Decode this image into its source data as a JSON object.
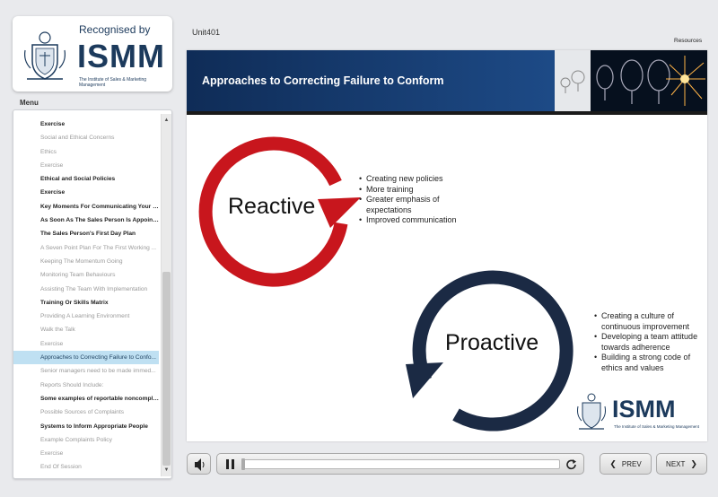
{
  "logo": {
    "recognised": "Recognised by",
    "brand": "ISMM",
    "tagline": "The Institute of Sales & Marketing Management"
  },
  "menu": {
    "title": "Menu",
    "items": [
      {
        "label": "Exercise",
        "state": "bold"
      },
      {
        "label": "Social and Ethical Concerns",
        "state": "done"
      },
      {
        "label": "Ethics",
        "state": "done"
      },
      {
        "label": "Exercise",
        "state": "done"
      },
      {
        "label": "Ethical and Social Policies",
        "state": "bold"
      },
      {
        "label": "Exercise",
        "state": "bold"
      },
      {
        "label": "Key Moments For Communicating Your E...",
        "state": "bold"
      },
      {
        "label": "As Soon As The Sales Person Is Appointed",
        "state": "bold"
      },
      {
        "label": "The Sales Person's First Day Plan",
        "state": "bold"
      },
      {
        "label": "A Seven Point Plan For The First Working ...",
        "state": "done"
      },
      {
        "label": "Keeping The Momentum Going",
        "state": "done"
      },
      {
        "label": "Monitoring Team Behaviours",
        "state": "done"
      },
      {
        "label": "Assisting The Team With Implementation",
        "state": "done"
      },
      {
        "label": "Training Or Skills Matrix",
        "state": "bold"
      },
      {
        "label": "Providing A Learning Environment",
        "state": "done"
      },
      {
        "label": "Walk the Talk",
        "state": "done"
      },
      {
        "label": "Exercise",
        "state": "done"
      },
      {
        "label": "Approaches to Correcting Failure to Confo...",
        "state": "active"
      },
      {
        "label": "Senior managers need to be made immed...",
        "state": "done"
      },
      {
        "label": "Reports Should Include:",
        "state": "done"
      },
      {
        "label": "Some examples of reportable noncomplia...",
        "state": "bold"
      },
      {
        "label": "Possible Sources of Complaints",
        "state": "done"
      },
      {
        "label": "Systems to Inform Appropriate People",
        "state": "bold"
      },
      {
        "label": "Example Complaints Policy",
        "state": "done"
      },
      {
        "label": "Exercise",
        "state": "done"
      },
      {
        "label": "End Of Session",
        "state": "done"
      }
    ]
  },
  "header": {
    "unit": "Unit401",
    "resources": "Resources"
  },
  "slide": {
    "title": "Approaches to Correcting Failure to Conform",
    "reactive": {
      "label": "Reactive",
      "bullets": [
        "Creating new policies",
        "More training",
        "Greater emphasis of expectations",
        "Improved communication"
      ]
    },
    "proactive": {
      "label": "Proactive",
      "bullets": [
        "Creating a culture of continuous improvement",
        "Developing a team attitude towards adherence",
        "Building a strong code of ethics and values"
      ]
    },
    "logo": {
      "brand": "ISMM",
      "tagline": "The Institute of Sales & Marketing Management"
    }
  },
  "controls": {
    "prev": "PREV",
    "next": "NEXT",
    "progress": 0.0
  },
  "colors": {
    "reactive": "#c8161d",
    "proactive": "#1b2a44",
    "active_menu": "#bfe0f2",
    "brand": "#1c3a5c"
  },
  "icons": [
    "speaker-icon",
    "pause-icon",
    "replay-icon",
    "chevron-left-icon",
    "chevron-right-icon",
    "crest-icon",
    "lightbulb-image"
  ]
}
